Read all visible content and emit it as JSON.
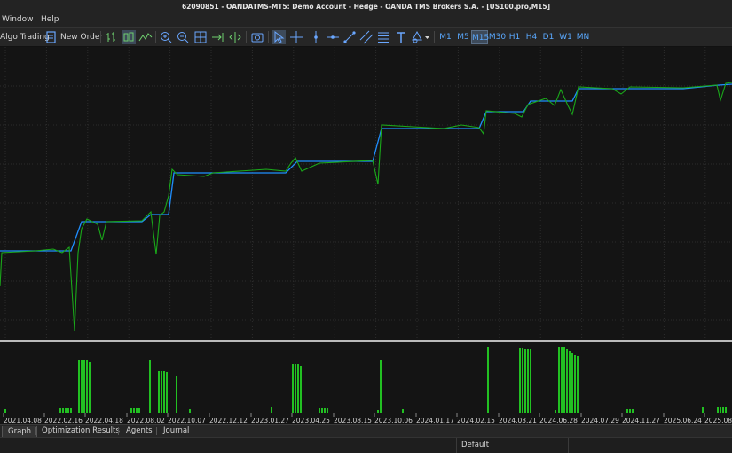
{
  "window": {
    "title": "62090851 - OANDATMS-MT5: Demo Account - Hedge - OANDA TMS Brokers S.A. - [US100.pro,M15]"
  },
  "menu": {
    "window": "Window",
    "help": "Help"
  },
  "toolbar": {
    "algo_trading": "Algo Trading",
    "new_order": "New Order",
    "timeframes": [
      "M1",
      "M5",
      "M15",
      "M30",
      "H1",
      "H4",
      "D1",
      "W1",
      "MN"
    ],
    "active_timeframe": "M15"
  },
  "chart_data": {
    "type": "line",
    "series": [
      {
        "color": "#1f8fff"
      },
      {
        "color": "#1aa81a"
      }
    ],
    "volume_color": "#22c022",
    "x": [
      "2021.04.08",
      "2022.02.16",
      "2022.04.18",
      "2022.08.02",
      "2022.10.07",
      "2022.12.12",
      "2023.01.27",
      "2023.04.25",
      "2023.08.15",
      "2023.10.06",
      "2024.01.17",
      "2024.02.15",
      "2024.03.21",
      "2024.06.28",
      "2024.07.29",
      "2024.11.27",
      "2025.06.24",
      "2025.08.1"
    ],
    "grid": true
  },
  "tabs": [
    "Graph",
    "Optimization Results",
    "Agents",
    "Journal"
  ],
  "active_tab": "Graph",
  "status": {
    "profile": "Default"
  }
}
